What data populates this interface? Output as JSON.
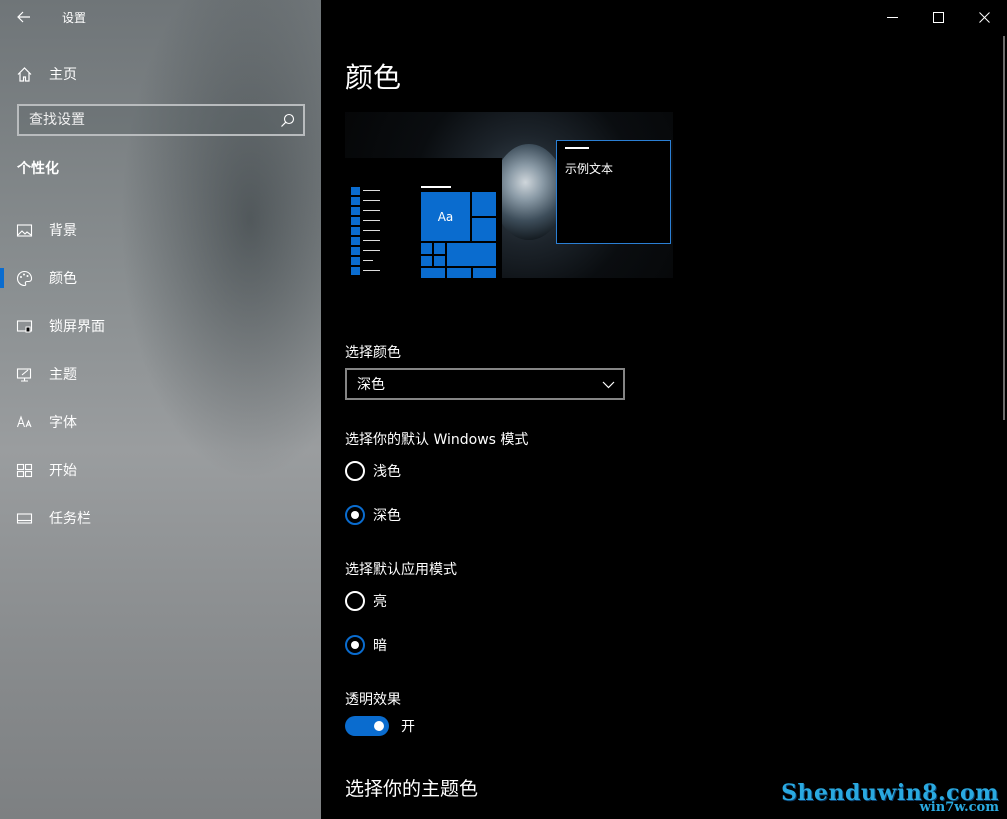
{
  "app": {
    "title": "设置"
  },
  "sidebar": {
    "home_label": "主页",
    "search_placeholder": "查找设置",
    "section": "个性化",
    "items": [
      {
        "label": "背景",
        "icon": "image-icon"
      },
      {
        "label": "颜色",
        "icon": "palette-icon",
        "active": true
      },
      {
        "label": "锁屏界面",
        "icon": "lock-screen-icon"
      },
      {
        "label": "主题",
        "icon": "theme-icon"
      },
      {
        "label": "字体",
        "icon": "font-icon"
      },
      {
        "label": "开始",
        "icon": "start-icon"
      },
      {
        "label": "任务栏",
        "icon": "taskbar-icon"
      }
    ]
  },
  "main": {
    "title": "颜色",
    "preview": {
      "tile_text": "Aa",
      "sample_text": "示例文本"
    },
    "choose_color": {
      "label": "选择颜色",
      "value": "深色"
    },
    "windows_mode": {
      "label": "选择你的默认 Windows 模式",
      "options": [
        {
          "label": "浅色",
          "selected": false
        },
        {
          "label": "深色",
          "selected": true
        }
      ]
    },
    "app_mode": {
      "label": "选择默认应用模式",
      "options": [
        {
          "label": "亮",
          "selected": false
        },
        {
          "label": "暗",
          "selected": true
        }
      ]
    },
    "transparency": {
      "label": "透明效果",
      "state": "开",
      "on": true
    },
    "accent_heading": "选择你的主题色"
  },
  "watermark": {
    "line1": "Shenduwin8.com",
    "line2": "win7w.com"
  },
  "colors": {
    "accent": "#0a6ccf",
    "background": "#000000"
  }
}
